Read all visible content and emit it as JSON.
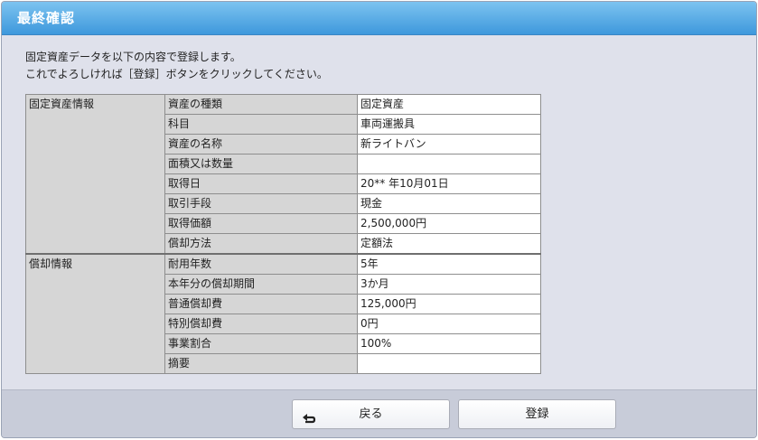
{
  "dialog": {
    "title": "最終確認"
  },
  "message": {
    "line1": "固定資産データを以下の内容で登録します。",
    "line2": "これでよろしければ［登録］ボタンをクリックしてください。"
  },
  "fixed_asset_info": {
    "group_label": "固定資産情報",
    "rows": [
      {
        "label": "資産の種類",
        "value": "固定資産"
      },
      {
        "label": "科目",
        "value": "車両運搬具"
      },
      {
        "label": "資産の名称",
        "value": "新ライトバン"
      },
      {
        "label": "面積又は数量",
        "value": ""
      },
      {
        "label": "取得日",
        "value": "20** 年10月01日"
      },
      {
        "label": "取引手段",
        "value": "現金"
      },
      {
        "label": "取得価額",
        "value": "2,500,000円"
      },
      {
        "label": "償却方法",
        "value": "定額法"
      }
    ]
  },
  "depreciation_info": {
    "group_label": "償却情報",
    "rows": [
      {
        "label": "耐用年数",
        "value": "5年"
      },
      {
        "label": "本年分の償却期間",
        "value": "3か月"
      },
      {
        "label": "普通償却費",
        "value": "125,000円"
      },
      {
        "label": "特別償却費",
        "value": "0円"
      },
      {
        "label": "事業割合",
        "value": "100%"
      },
      {
        "label": "摘要",
        "value": ""
      }
    ]
  },
  "buttons": {
    "back_label": "戻る",
    "back_icon": "return-arrow-icon",
    "register_label": "登録"
  },
  "colors": {
    "title_bar": "#3e98dc",
    "label_cell": "#d6d6d6",
    "value_cell": "#ffffff"
  }
}
